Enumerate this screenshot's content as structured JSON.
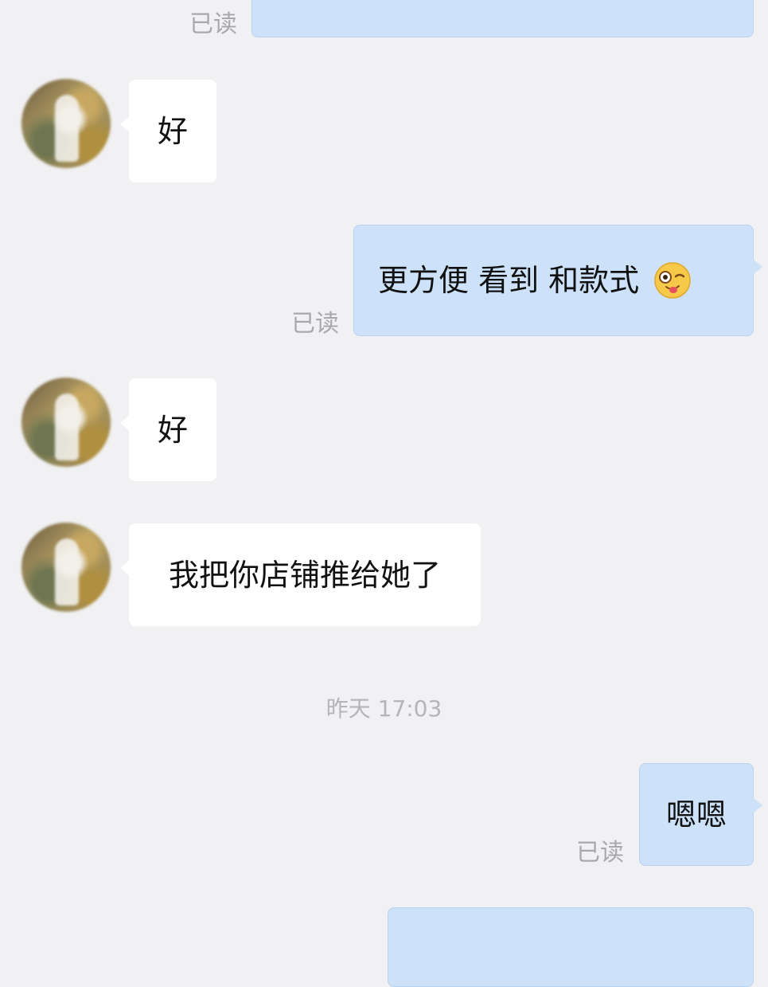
{
  "messages": {
    "m0": {
      "text": "",
      "read": "已读"
    },
    "m1": {
      "text": "好"
    },
    "m2": {
      "text": "更方便 看到 和款式",
      "emoji": "winking-tongue-face-icon",
      "read": "已读"
    },
    "m3": {
      "text": "好"
    },
    "m4": {
      "text": "我把你店铺推给她了"
    },
    "m5": {
      "text": "嗯嗯",
      "read": "已读"
    },
    "m6": {
      "text": ""
    }
  },
  "timestamp": "昨天 17:03",
  "colors": {
    "background": "#f1f1f3",
    "outgoing_bubble": "#cde1f9",
    "incoming_bubble": "#ffffff",
    "read_receipt": "#a9a9ad"
  }
}
